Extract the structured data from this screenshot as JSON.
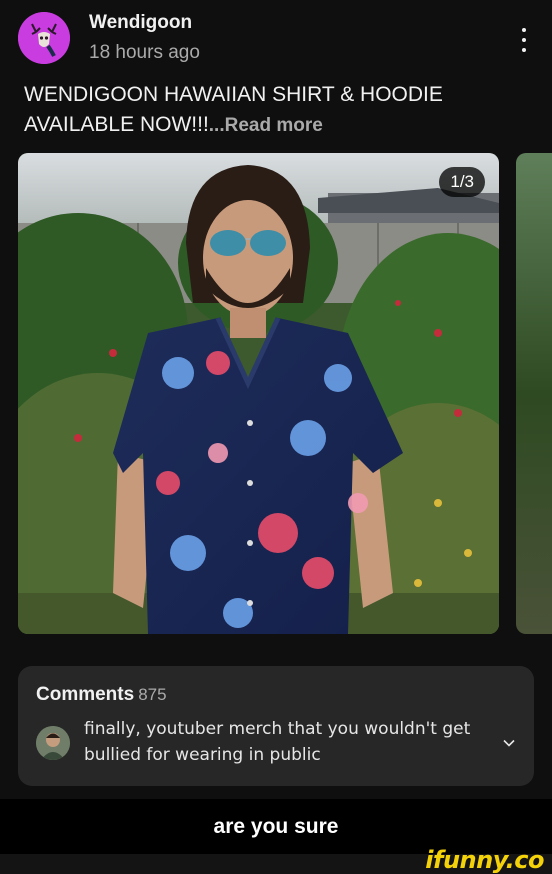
{
  "post": {
    "author": "Wendigoon",
    "time": "18 hours ago",
    "text": "WENDIGOON HAWAIIAN SHIRT & HOODIE AVAILABLE NOW!!!",
    "read_more": "...Read more",
    "menu_icon": "kebab-vertical-icon",
    "image_counter": "1/3"
  },
  "comments": {
    "title": "Comments",
    "count": "875",
    "top_comment": "finally, youtuber merch that you wouldn't get bullied for wearing in public",
    "expand_icon": "chevron-down-icon"
  },
  "caption": "are you sure",
  "watermark": "ifunny.co",
  "colors": {
    "background": "#0f0f0f",
    "card": "#272727",
    "avatar_bg": "#c83ce0",
    "secondary_text": "#aaaaaa",
    "watermark": "#f4d20a"
  }
}
